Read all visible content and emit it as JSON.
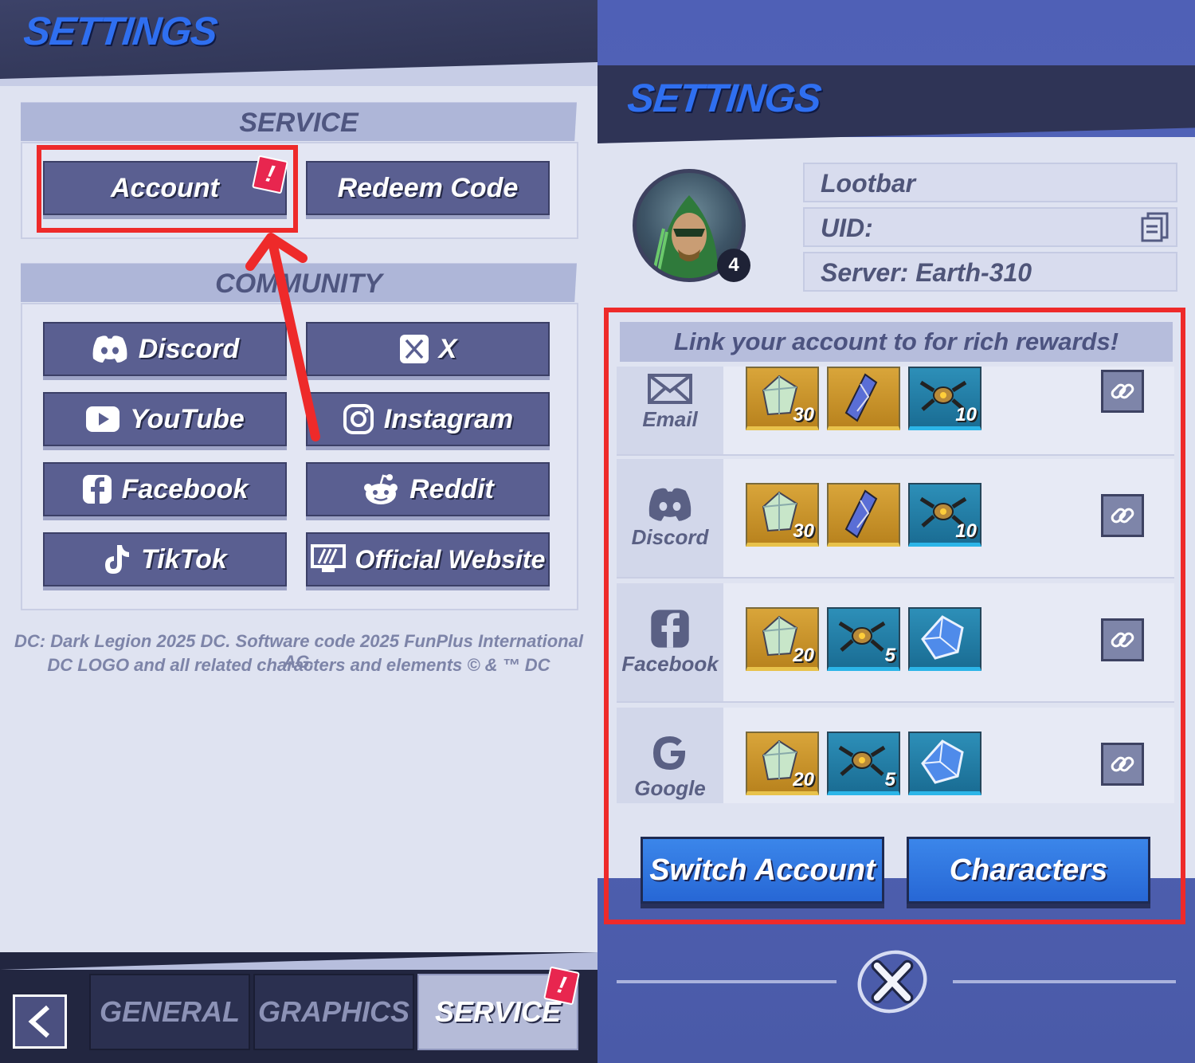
{
  "left_panel": {
    "title": "SETTINGS",
    "service_section": {
      "heading": "SERVICE",
      "account_label": "Account",
      "account_notice": "!",
      "redeem_label": "Redeem Code"
    },
    "community_section": {
      "heading": "COMMUNITY",
      "buttons": [
        {
          "label": "Discord",
          "icon": "discord-icon"
        },
        {
          "label": "X",
          "icon": "x-icon"
        },
        {
          "label": "YouTube",
          "icon": "youtube-icon"
        },
        {
          "label": "Instagram",
          "icon": "instagram-icon"
        },
        {
          "label": "Facebook",
          "icon": "facebook-icon"
        },
        {
          "label": "Reddit",
          "icon": "reddit-icon"
        },
        {
          "label": "TikTok",
          "icon": "tiktok-icon"
        },
        {
          "label": "Official Website",
          "icon": "website-icon"
        }
      ]
    },
    "footer": {
      "line1": "DC: Dark Legion 2025 DC. Software code 2025 FunPlus International AG.",
      "line2": "DC LOGO and all related characters and elements © & ™ DC"
    },
    "tabs": [
      {
        "label": "GENERAL",
        "active": false
      },
      {
        "label": "GRAPHICS",
        "active": false
      },
      {
        "label": "SERVICE",
        "active": true
      }
    ],
    "service_tab_notice": "!"
  },
  "right_panel": {
    "title": "SETTINGS",
    "profile": {
      "name": "Lootbar",
      "uid_label": "UID:",
      "server": "Server: Earth-310",
      "level": "4"
    },
    "link_heading": "Link your account to for rich rewards!",
    "link_rows": [
      {
        "platform": "Email",
        "rewards": [
          {
            "type": "crystal",
            "count": "30",
            "color": "gold"
          },
          {
            "type": "shard",
            "count": "",
            "color": "gold"
          },
          {
            "type": "drone",
            "count": "10",
            "color": "blue"
          }
        ]
      },
      {
        "platform": "Discord",
        "rewards": [
          {
            "type": "crystal",
            "count": "30",
            "color": "gold"
          },
          {
            "type": "shard",
            "count": "",
            "color": "gold"
          },
          {
            "type": "drone",
            "count": "10",
            "color": "blue"
          }
        ]
      },
      {
        "platform": "Facebook",
        "rewards": [
          {
            "type": "crystal",
            "count": "20",
            "color": "gold"
          },
          {
            "type": "drone",
            "count": "5",
            "color": "blue"
          },
          {
            "type": "cube",
            "count": "",
            "color": "blue"
          }
        ]
      },
      {
        "platform": "Google",
        "rewards": [
          {
            "type": "crystal",
            "count": "20",
            "color": "gold"
          },
          {
            "type": "drone",
            "count": "5",
            "color": "blue"
          },
          {
            "type": "cube",
            "count": "",
            "color": "blue"
          }
        ]
      }
    ],
    "switch_account_label": "Switch Account",
    "characters_label": "Characters"
  },
  "colors": {
    "accent_blue": "#2f6ff0",
    "button_purple": "#5a5f91",
    "notice_red": "#e8264f",
    "highlight_red": "#ee2a2a"
  }
}
